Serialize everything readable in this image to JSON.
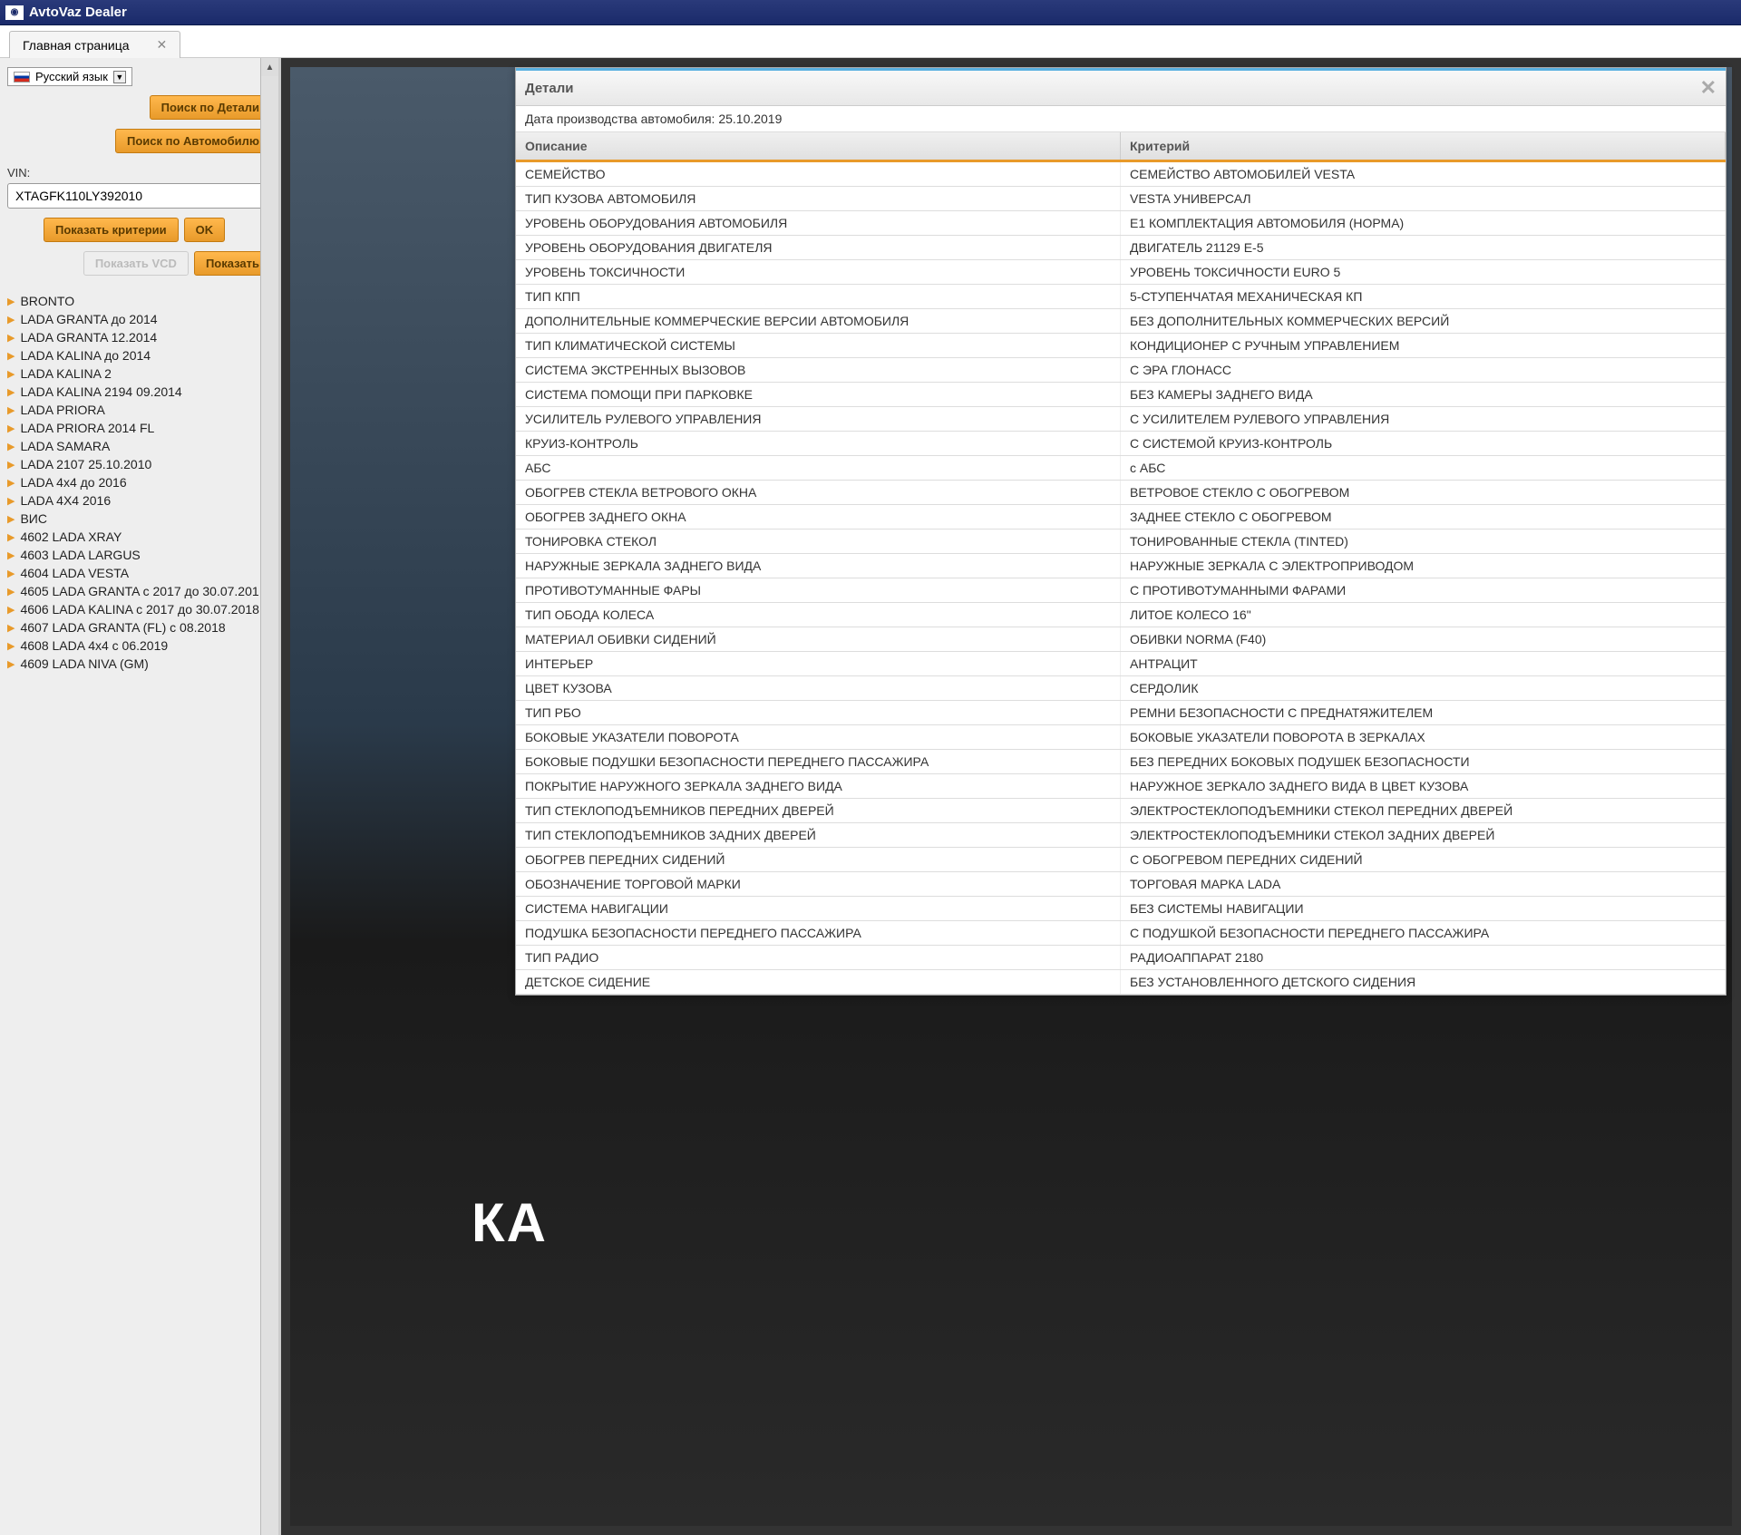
{
  "app": {
    "title": "AvtoVaz Dealer"
  },
  "tabs": [
    {
      "label": "Главная страница"
    }
  ],
  "sidebar": {
    "language": "Русский язык",
    "search_detail_btn": "Поиск по Детали",
    "search_car_btn": "Поиск по Автомобилю",
    "vin_label": "VIN:",
    "vin_value": "XTAGFK110LY392010",
    "show_criteria_btn": "Показать критерии",
    "ok_btn": "OK",
    "show_vcd_btn": "Показать VCD",
    "show_btn": "Показать",
    "tree": [
      "BRONTO",
      "LADA GRANTA до 2014",
      "LADA GRANTA 12.2014",
      "LADA KALINA до 2014",
      "LADA KALINA 2",
      "LADA KALINA 2194 09.2014",
      "LADA PRIORA",
      "LADA PRIORA 2014 FL",
      "LADA SAMARA",
      "LADA 2107 25.10.2010",
      "LADA 4x4 до 2016",
      "LADA 4X4 2016",
      "ВИС",
      "4602 LADA XRAY",
      "4603 LADA LARGUS",
      "4604 LADA VESTA",
      "4605 LADA GRANTA с 2017 до 30.07.201",
      "4606 LADA KALINA с 2017 до 30.07.2018",
      "4607 LADA GRANTA (FL) с 08.2018",
      "4608 LADA 4x4 с 06.2019",
      "4609 LADA NIVA (GM)"
    ]
  },
  "main": {
    "bg_text": "КА"
  },
  "details": {
    "title": "Детали",
    "production_date": "Дата производства автомобиля: 25.10.2019",
    "col_description": "Описание",
    "col_criterion": "Критерий",
    "rows": [
      {
        "d": "СЕМЕЙСТВО",
        "c": "СЕМЕЙСТВО АВТОМОБИЛЕЙ VESTA"
      },
      {
        "d": "ТИП КУЗОВА АВТОМОБИЛЯ",
        "c": "VESTA УНИВЕРСАЛ"
      },
      {
        "d": "УРОВЕНЬ ОБОРУДОВАНИЯ АВТОМОБИЛЯ",
        "c": "E1 КОМПЛЕКТАЦИЯ АВТОМОБИЛЯ (НОРМА)"
      },
      {
        "d": "УРОВЕНЬ ОБОРУДОВАНИЯ ДВИГАТЕЛЯ",
        "c": "ДВИГАТЕЛЬ 21129 Е-5"
      },
      {
        "d": "УРОВЕНЬ ТОКСИЧНОСТИ",
        "c": "УРОВЕНЬ ТОКСИЧНОСТИ EURO 5"
      },
      {
        "d": "ТИП КПП",
        "c": "5-СТУПЕНЧАТАЯ МЕХАНИЧЕСКАЯ КП"
      },
      {
        "d": "ДОПОЛНИТЕЛЬНЫЕ КОММЕРЧЕСКИЕ ВЕРСИИ АВТОМОБИЛЯ",
        "c": "БЕЗ ДОПОЛНИТЕЛЬНЫХ КОММЕРЧЕСКИХ ВЕРСИЙ"
      },
      {
        "d": "ТИП КЛИМАТИЧЕСКОЙ СИСТЕМЫ",
        "c": "КОНДИЦИОНЕР С РУЧНЫМ УПРАВЛЕНИЕМ"
      },
      {
        "d": "СИСТЕМА ЭКСТРЕННЫХ ВЫЗОВОВ",
        "c": "С ЭРА ГЛОНАСС"
      },
      {
        "d": "СИСТЕМА ПОМОЩИ ПРИ ПАРКОВКЕ",
        "c": "БЕЗ КАМЕРЫ ЗАДНЕГО ВИДА"
      },
      {
        "d": "УСИЛИТЕЛЬ РУЛЕВОГО УПРАВЛЕНИЯ",
        "c": "С УСИЛИТЕЛЕМ РУЛЕВОГО УПРАВЛЕНИЯ"
      },
      {
        "d": "КРУИЗ-КОНТРОЛЬ",
        "c": "С СИСТЕМОЙ КРУИЗ-КОНТРОЛЬ"
      },
      {
        "d": "АБС",
        "c": "с АБС"
      },
      {
        "d": "ОБОГРЕВ СТЕКЛА ВЕТРОВОГО ОКНА",
        "c": "ВЕТРОВОЕ СТЕКЛО С ОБОГРЕВОМ"
      },
      {
        "d": "ОБОГРЕВ ЗАДНЕГО ОКНА",
        "c": "ЗАДНЕЕ СТЕКЛО С ОБОГРЕВОМ"
      },
      {
        "d": "ТОНИРОВКА СТЕКОЛ",
        "c": "ТОНИРОВАННЫЕ СТЕКЛА (TINTED)"
      },
      {
        "d": "НАРУЖНЫЕ ЗЕРКАЛА ЗАДНЕГО ВИДА",
        "c": "НАРУЖНЫЕ ЗЕРКАЛА С ЭЛЕКТРОПРИВОДОМ"
      },
      {
        "d": "ПРОТИВОТУМАННЫЕ ФАРЫ",
        "c": "С ПРОТИВОТУМАННЫМИ ФАРАМИ"
      },
      {
        "d": "ТИП ОБОДА КОЛЕСА",
        "c": "ЛИТОЕ КОЛЕСО 16\""
      },
      {
        "d": "МАТЕРИАЛ ОБИВКИ СИДЕНИЙ",
        "c": "ОБИВКИ NORMA (F40)"
      },
      {
        "d": "ИНТЕРЬЕР",
        "c": "АНТРАЦИТ"
      },
      {
        "d": "ЦВЕТ КУЗОВА",
        "c": "СЕРДОЛИК"
      },
      {
        "d": "ТИП РБО",
        "c": "РЕМНИ БЕЗОПАСНОСТИ С ПРЕДНАТЯЖИТЕЛЕМ"
      },
      {
        "d": "БОКОВЫЕ УКАЗАТЕЛИ ПОВОРОТА",
        "c": "БОКОВЫЕ УКАЗАТЕЛИ ПОВОРОТА В ЗЕРКАЛАХ"
      },
      {
        "d": "БОКОВЫЕ ПОДУШКИ БЕЗОПАСНОСТИ ПЕРЕДНЕГО ПАССАЖИРА",
        "c": "БЕЗ ПЕРЕДНИХ БОКОВЫХ ПОДУШЕК БЕЗОПАСНОСТИ"
      },
      {
        "d": "ПОКРЫТИЕ НАРУЖНОГО ЗЕРКАЛА ЗАДНЕГО ВИДА",
        "c": "НАРУЖНОЕ ЗЕРКАЛО ЗАДНЕГО ВИДА В ЦВЕТ КУЗОВА"
      },
      {
        "d": "ТИП СТЕКЛОПОДЪЕМНИКОВ ПЕРЕДНИХ ДВЕРЕЙ",
        "c": "ЭЛЕКТРОСТЕКЛОПОДЪЕМНИКИ СТЕКОЛ ПЕРЕДНИХ ДВЕРЕЙ"
      },
      {
        "d": "ТИП СТЕКЛОПОДЪЕМНИКОВ ЗАДНИХ ДВЕРЕЙ",
        "c": "ЭЛЕКТРОСТЕКЛОПОДЪЕМНИКИ СТЕКОЛ ЗАДНИХ ДВЕРЕЙ"
      },
      {
        "d": "ОБОГРЕВ ПЕРЕДНИХ СИДЕНИЙ",
        "c": "С ОБОГРЕВОМ ПЕРЕДНИХ СИДЕНИЙ"
      },
      {
        "d": "ОБОЗНАЧЕНИЕ ТОРГОВОЙ МАРКИ",
        "c": "ТОРГОВАЯ МАРКА LADA"
      },
      {
        "d": "СИСТЕМА НАВИГАЦИИ",
        "c": "БЕЗ СИСТЕМЫ НАВИГАЦИИ"
      },
      {
        "d": "ПОДУШКА БЕЗОПАСНОСТИ ПЕРЕДНЕГО ПАССАЖИРА",
        "c": "С ПОДУШКОЙ БЕЗОПАСНОСТИ ПЕРЕДНЕГО ПАССАЖИРА"
      },
      {
        "d": "ТИП РАДИО",
        "c": "РАДИОАППАРАТ 2180"
      },
      {
        "d": "ДЕТСКОЕ СИДЕНИЕ",
        "c": "БЕЗ УСТАНОВЛЕННОГО ДЕТСКОГО СИДЕНИЯ"
      }
    ]
  }
}
